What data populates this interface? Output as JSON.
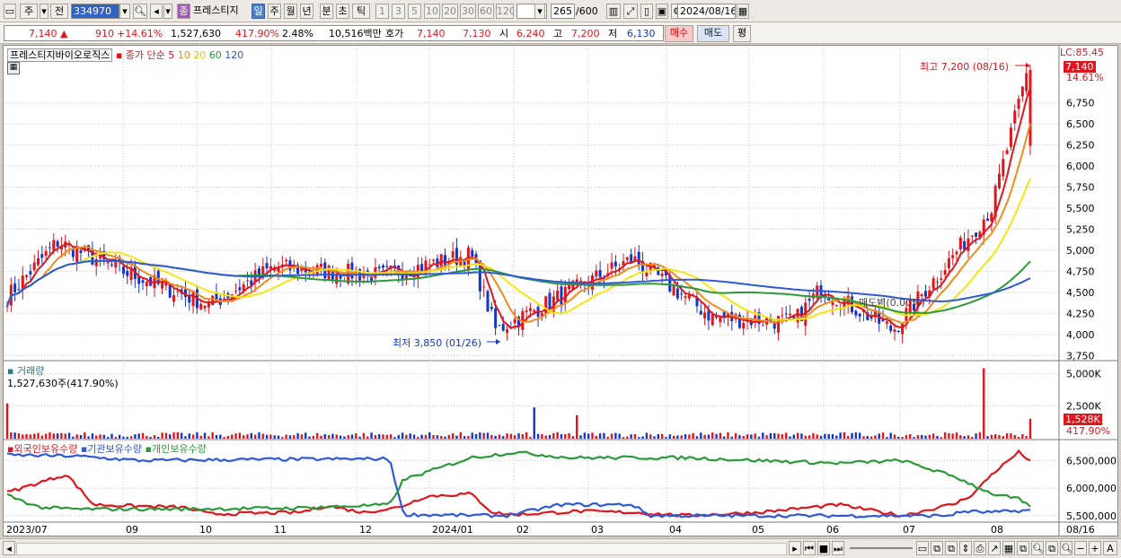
{
  "toolbar": {
    "market": "주",
    "prefix": "전",
    "code": "334970",
    "name_badge": "종",
    "name": "프레스티지",
    "periods": [
      "일",
      "주",
      "월",
      "년",
      "분",
      "초",
      "틱"
    ],
    "active_period": "일",
    "minutes": [
      "1",
      "3",
      "5",
      "10",
      "20",
      "30",
      "60",
      "120"
    ],
    "count": "265",
    "count_total": "/600",
    "date": "2024/08/16"
  },
  "quote": {
    "price": "7,140",
    "arrow": "▲",
    "change": "910",
    "change_pct": "+14.61%",
    "volume": "1,527,630",
    "volume_ratio": "417.90%",
    "turnover": "2.48%",
    "amount": "10,516백만",
    "ask_label": "호가",
    "ask": "7,140",
    "bid": "7,130",
    "open_label": "시",
    "open": "6,240",
    "high_label": "고",
    "high": "7,200",
    "low_label": "저",
    "low": "6,130",
    "buy_btn": "매수",
    "sell_btn": "매도",
    "eval_btn": "평"
  },
  "price_panel": {
    "stock_tag": "프레스티지바이오로직스",
    "ma_label": "종가 단순",
    "ma_periods": [
      "5",
      "10",
      "20",
      "60",
      "120"
    ],
    "ma_colors": [
      "#e0161e",
      "#f08c1e",
      "#f5e612",
      "#2a9a3a",
      "#2f59d8"
    ],
    "lc": "LC:85.45",
    "last_tag": "7,140",
    "pct_tag": "14.61%",
    "high_note": "최고 7,200 (08/16)",
    "low_note": "최저 3,850 (01/26)",
    "mid_note": "매도벽(0.00%)"
  },
  "volume_panel": {
    "title": "거래량",
    "value_line": "1,527,630주(417.90%)",
    "last_tag": "1,528K",
    "pct_tag": "417.90%"
  },
  "holding_panel": {
    "legend": [
      "외국인보유수량",
      "기관보유수량",
      "개인보유수량"
    ],
    "colors": [
      "#e0161e",
      "#2f59d8",
      "#2a9a3a"
    ]
  },
  "chart_data": [
    {
      "type": "candlestick",
      "title": "프레스티지바이오로직스",
      "ylim": [
        3700,
        7300
      ],
      "yticks": [
        3750,
        4000,
        4250,
        4500,
        4750,
        5000,
        5250,
        5500,
        5750,
        6000,
        6250,
        6500,
        6750
      ],
      "x_tick_labels": [
        "2023/07",
        "09",
        "10",
        "11",
        "12",
        "2024/01",
        "02",
        "03",
        "04",
        "05",
        "06",
        "07",
        "08",
        "08/16"
      ],
      "ohlc_keypoints": [
        {
          "date": "2023/07 start",
          "close": 4400
        },
        {
          "date": "2023/08",
          "close": 5100
        },
        {
          "date": "2023/09",
          "close": 4750
        },
        {
          "date": "2023/10",
          "close": 4350
        },
        {
          "date": "2023/11",
          "close": 4800
        },
        {
          "date": "2023/12",
          "close": 4700
        },
        {
          "date": "2024/01",
          "close": 4950
        },
        {
          "date": "2024/01/26",
          "close": 4050,
          "low": 3850
        },
        {
          "date": "2024/03",
          "close": 4900
        },
        {
          "date": "2024/04",
          "close": 4200
        },
        {
          "date": "2024/05",
          "close": 4150
        },
        {
          "date": "2024/06",
          "close": 4550
        },
        {
          "date": "2024/07",
          "close": 4050
        },
        {
          "date": "2024/08",
          "close": 5500
        },
        {
          "date": "2024/08/16",
          "open": 6240,
          "high": 7200,
          "low": 6130,
          "close": 7140
        }
      ],
      "series": [
        {
          "name": "5",
          "color": "#e0161e"
        },
        {
          "name": "10",
          "color": "#f08c1e"
        },
        {
          "name": "20",
          "color": "#f5e612"
        },
        {
          "name": "60",
          "color": "#2a9a3a"
        },
        {
          "name": "120",
          "color": "#2f59d8"
        }
      ]
    },
    {
      "type": "bar",
      "title": "거래량",
      "yticks": [
        "2,500K",
        "5,000K"
      ],
      "last_value": 1527630
    },
    {
      "type": "line",
      "series": [
        {
          "name": "외국인보유수량",
          "color": "#e0161e"
        },
        {
          "name": "기관보유수량",
          "color": "#2f59d8"
        },
        {
          "name": "개인보유수량",
          "color": "#2a9a3a"
        }
      ],
      "yticks": [
        "5,500,000",
        "6,000,000",
        "6,500,000"
      ]
    }
  ]
}
